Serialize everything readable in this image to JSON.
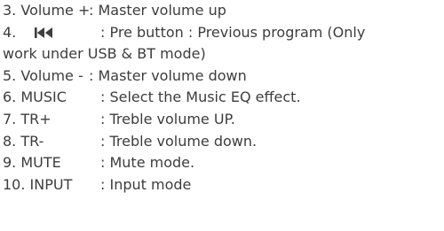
{
  "items": [
    {
      "num": "3.",
      "key": "Volume +",
      "desc": ": Master volume up"
    },
    {
      "num": "4.",
      "icon": "previous-track-icon",
      "desc": ": Pre button : Previous program (Only",
      "cont": "work under USB & BT mode)"
    },
    {
      "num": "5.",
      "key": "Volume -",
      "desc": ": Master volume down"
    },
    {
      "num": "6.",
      "key": "MUSIC",
      "desc": ": Select the Music EQ effect."
    },
    {
      "num": "7.",
      "key": "TR+",
      "desc": ": Treble volume UP."
    },
    {
      "num": "8.",
      "key": "TR-",
      "desc": ": Treble volume down."
    },
    {
      "num": "9.",
      "key": "MUTE",
      "desc": ": Mute mode."
    },
    {
      "num": "10.",
      "key": "INPUT",
      "desc": ": Input mode"
    }
  ],
  "colors": {
    "text": "#3d3d3d",
    "background": "#ffffff"
  }
}
